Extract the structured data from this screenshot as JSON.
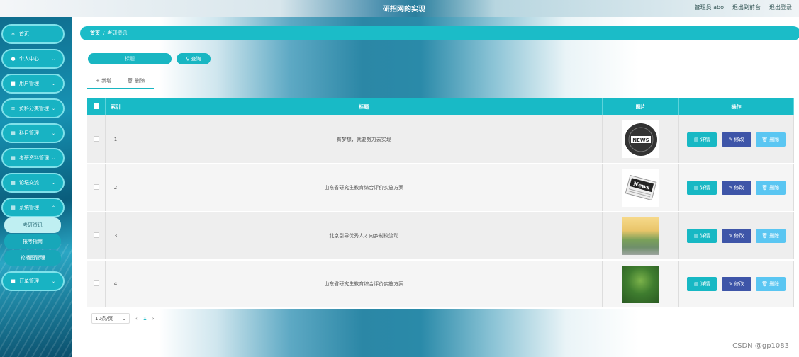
{
  "header": {
    "title": "研招网的实现",
    "admin_label": "管理员 abo",
    "to_front": "退出到前台",
    "logout": "退出登录"
  },
  "sidebar": {
    "items": [
      {
        "label": "首页",
        "icon": "home-icon",
        "glyph": "⌂"
      },
      {
        "label": "个人中心",
        "icon": "user-icon",
        "glyph": "●"
      },
      {
        "label": "用户管理",
        "icon": "card-icon",
        "glyph": "■"
      },
      {
        "label": "资料分类管理",
        "icon": "sliders-icon",
        "glyph": "≡"
      },
      {
        "label": "科目管理",
        "icon": "grid-icon",
        "glyph": "▦"
      },
      {
        "label": "考研资料管理",
        "icon": "grid-icon",
        "glyph": "▦"
      },
      {
        "label": "论坛交流",
        "icon": "grid-icon",
        "glyph": "▦"
      },
      {
        "label": "系统管理",
        "icon": "grid-icon",
        "glyph": "▦"
      },
      {
        "label": "订单管理",
        "icon": "doc-icon",
        "glyph": "■"
      }
    ],
    "submenu": [
      "考研资讯",
      "报考指南",
      "轮播图管理"
    ]
  },
  "breadcrumb": {
    "home": "首页",
    "separator": "/",
    "current": "考研资讯"
  },
  "search": {
    "placeholder": "标题",
    "button": "查询"
  },
  "actions": {
    "add": "+ 新增",
    "delete": "删除"
  },
  "table": {
    "headers": {
      "index": "索引",
      "title": "标题",
      "image": "图片",
      "ops": "操作"
    },
    "rows": [
      {
        "index": "1",
        "title": "有梦想，就要努力去实现",
        "image": "news-globe"
      },
      {
        "index": "2",
        "title": "山东省研究生教育综合评价实施方案",
        "image": "news-paper"
      },
      {
        "index": "3",
        "title": "北京引导优秀人才向乡村校流动",
        "image": "campus-sunset"
      },
      {
        "index": "4",
        "title": "山东省研究生教育综合评价实施方案",
        "image": "park-path"
      }
    ],
    "ops": {
      "detail": "详情",
      "edit": "修改",
      "delete": "删除"
    }
  },
  "pager": {
    "page_size": "10条/页",
    "prev": "‹",
    "current": "1",
    "next": "›"
  },
  "watermark": "CSDN @gp1083",
  "colors": {
    "accent": "#18bac6",
    "edit": "#3e55a8",
    "delete": "#5ac6f2"
  }
}
